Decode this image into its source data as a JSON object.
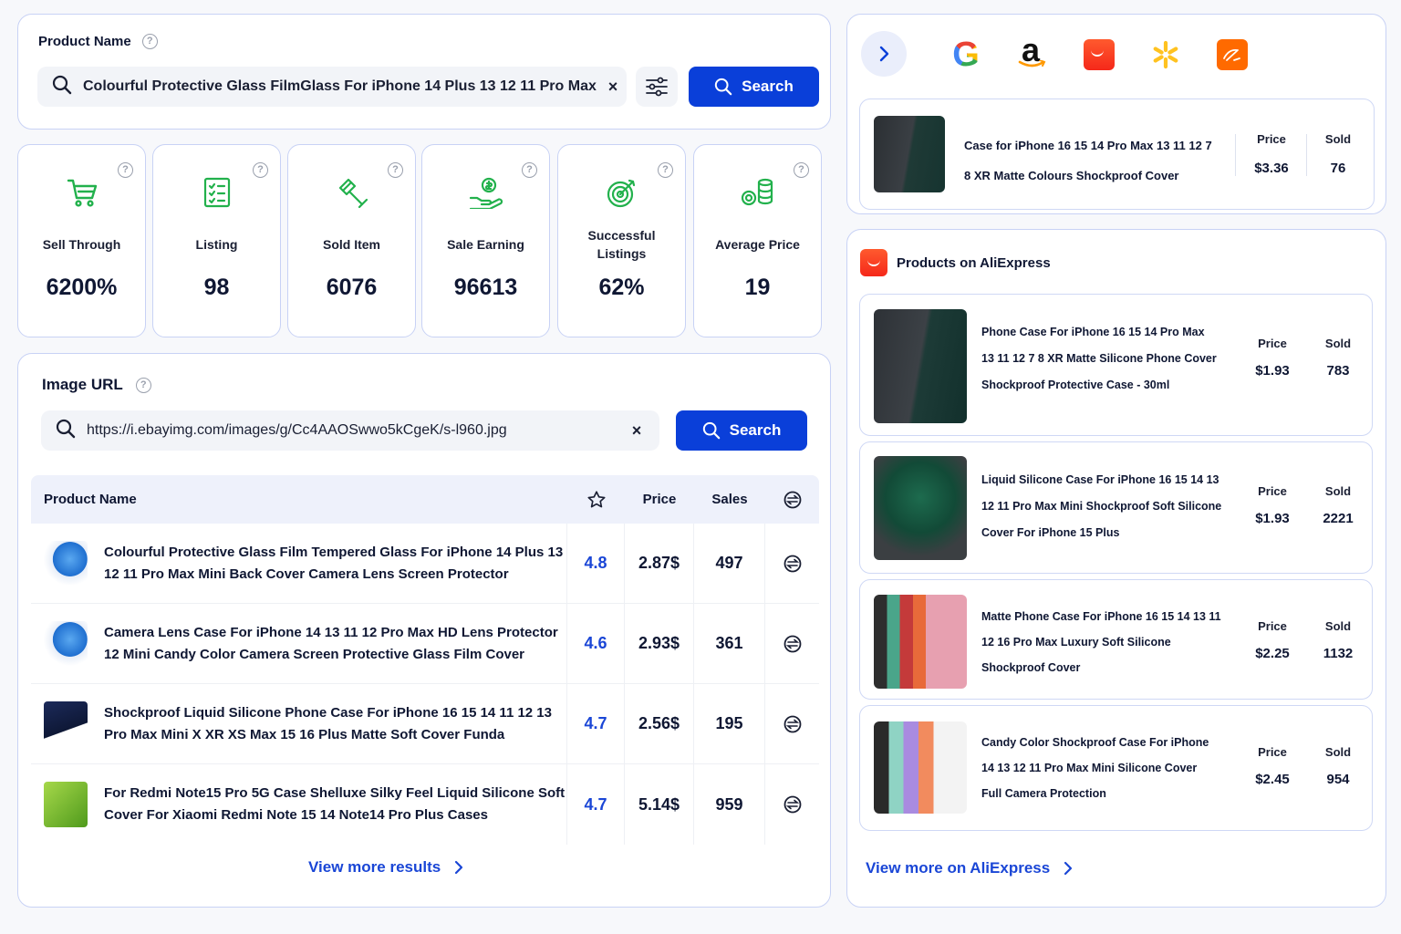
{
  "product_search": {
    "title": "Product Name",
    "query": "Colourful Protective Glass FilmGlass For iPhone 14 Plus 13 12 11 Pro Max",
    "clear": "×",
    "search_label": "Search"
  },
  "stats": [
    {
      "label": "Sell Through",
      "value": "6200%",
      "icon": "cart-icon"
    },
    {
      "label": "Listing",
      "value": "98",
      "icon": "checklist-icon"
    },
    {
      "label": "Sold Item",
      "value": "6076",
      "icon": "gavel-icon"
    },
    {
      "label": "Sale Earning",
      "value": "96613",
      "icon": "money-hand-icon"
    },
    {
      "label": "Successful Listings",
      "value": "62%",
      "icon": "target-icon"
    },
    {
      "label": "Average Price",
      "value": "19",
      "icon": "coins-icon"
    }
  ],
  "image_search": {
    "title": "Image URL",
    "url": "https://i.ebayimg.com/images/g/Cc4AAOSwwo5kCgeK/s-l960.jpg",
    "clear": "×",
    "search_label": "Search"
  },
  "table": {
    "headers": {
      "name": "Product Name",
      "price": "Price",
      "sales": "Sales"
    },
    "rows": [
      {
        "name": "Colourful Protective Glass Film Tempered Glass For iPhone 14 Plus 13 12 11 Pro Max Mini Back Cover Camera Lens Screen Protector",
        "rating": "4.8",
        "price": "2.87$",
        "sales": "497"
      },
      {
        "name": "Camera Lens Case For iPhone 14 13 11 12 Pro Max HD Lens Protector 12 Mini Candy Color Camera Screen Protective Glass Film Cover",
        "rating": "4.6",
        "price": "2.93$",
        "sales": "361"
      },
      {
        "name": "Shockproof Liquid Silicone Phone Case For iPhone 16 15 14 11 12 13 Pro Max Mini X XR XS Max 15 16 Plus Matte Soft Cover Funda",
        "rating": "4.7",
        "price": "2.56$",
        "sales": "195"
      },
      {
        "name": "For Redmi Note15 Pro 5G Case Shelluxe Silky Feel Liquid Silicone Soft Cover For Xiaomi Redmi Note 15 14 Note14 Pro Plus Cases",
        "rating": "4.7",
        "price": "5.14$",
        "sales": "959"
      }
    ],
    "view_more": "View more results"
  },
  "sources": {
    "icons": [
      "google-icon",
      "amazon-icon",
      "aliexpress-icon",
      "walmart-icon",
      "alibaba-icon"
    ],
    "google_letter": "G",
    "amazon_letter": "a",
    "featured": {
      "title": "Case for iPhone 16 15 14 Pro Max 13 11 12 7 8 XR Matte Colours Shockproof Cover",
      "price_label": "Price",
      "sold_label": "Sold",
      "price": "$3.36",
      "sold": "76"
    }
  },
  "aliexpress": {
    "title": "Products on AliExpress",
    "products": [
      {
        "title": "Phone Case For iPhone 16 15 14 Pro Max 13 11 12 7 8 XR Matte Silicone Phone Cover Shockproof Protective Case - 30ml",
        "price": "$1.93",
        "sold": "783"
      },
      {
        "title": "Liquid Silicone Case For iPhone 16 15 14 13 12 11 Pro Max Mini Shockproof Soft Silicone Cover For iPhone 15 Plus",
        "price": "$1.93",
        "sold": "2221"
      },
      {
        "title": "Matte Phone Case For iPhone 16 15 14 13 11 12 16 Pro Max Luxury Soft Silicone Shockproof Cover",
        "price": "$2.25",
        "sold": "1132"
      },
      {
        "title": "Candy Color Shockproof Case For iPhone 14 13 12 11 Pro Max Mini Silicone Cover Full Camera Protection",
        "price": "$2.45",
        "sold": "954"
      }
    ],
    "price_label": "Price",
    "sold_label": "Sold",
    "view_more": "View more on AliExpress"
  },
  "colors": {
    "accent": "#0a3fd9",
    "link": "#1a46d6",
    "icon_green": "#22b14c",
    "border": "#c8d2f5"
  }
}
